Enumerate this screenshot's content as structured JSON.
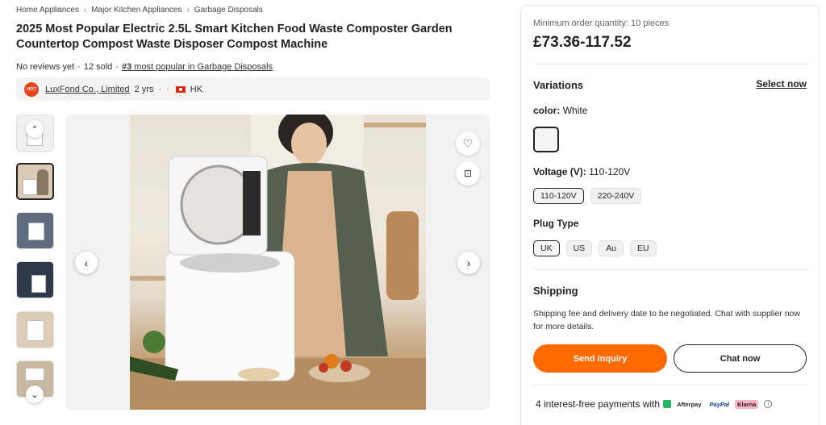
{
  "breadcrumb": [
    "Home Appliances",
    "Major Kitchen Appliances",
    "Garbage Disposals"
  ],
  "product": {
    "title": "2025 Most Popular Electric 2.5L Smart Kitchen Food Waste Composter Garden Countertop Compost Waste Disposer Compost Machine",
    "reviews": "No reviews yet",
    "sold": "12 sold",
    "rank_number": "#3",
    "rank_text": "most popular in Garbage Disposals"
  },
  "supplier": {
    "logo_text": "HOT",
    "name": "LuxFond Co., Limited",
    "years": "2 yrs",
    "country": "HK"
  },
  "gallery": {
    "thumb_count": 6,
    "active_index": 1
  },
  "panel": {
    "moq": "Minimum order quantity: 10 pieces",
    "price": "£73.36-117.52",
    "variations_title": "Variations",
    "select_now": "Select now",
    "color_label": "color:",
    "color_value": "White",
    "voltage_label": "Voltage (V):",
    "voltage_value": "110-120V",
    "voltage_options": [
      "110-120V",
      "220-240V"
    ],
    "plug_label": "Plug Type",
    "plug_options": [
      "UK",
      "US",
      "Au",
      "EU"
    ],
    "shipping_title": "Shipping",
    "shipping_text": "Shipping fee and delivery date to be negotiated. Chat with supplier now for more details.",
    "send_inquiry": "Send inquiry",
    "chat_now": "Chat now",
    "payments_text": "4 interest-free payments with",
    "pay_afterpay": "Afterpay",
    "pay_paypal": "PayPal",
    "pay_klarna": "Klarna"
  },
  "colors": {
    "accent": "#ff6a00",
    "logo": "#e8461f"
  }
}
